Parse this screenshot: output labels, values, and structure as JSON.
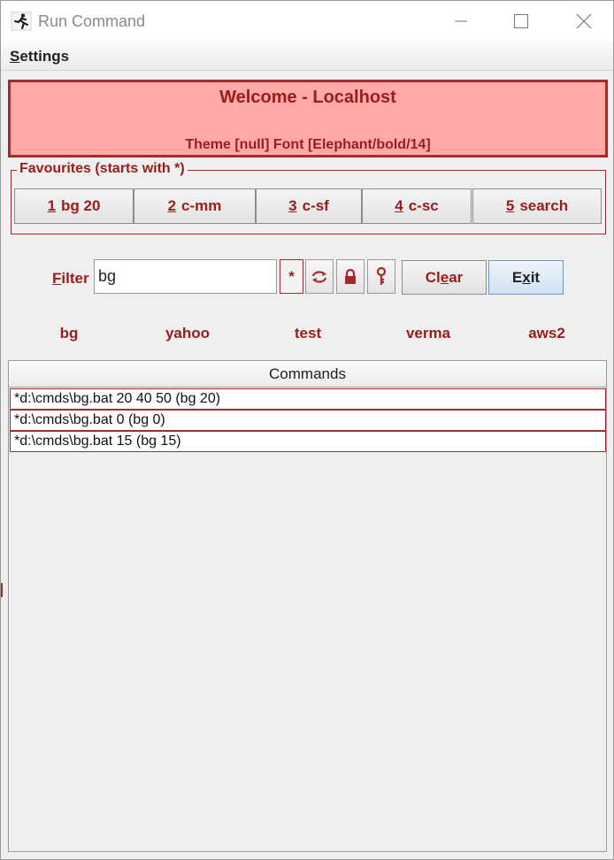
{
  "window": {
    "title": "Run Command",
    "icon": "running-man-icon",
    "controls": [
      "minimize-icon",
      "maximize-icon",
      "close-icon"
    ]
  },
  "menu": {
    "settings_mnemonic": "S",
    "settings_rest": "ettings"
  },
  "banner": {
    "title": "Welcome - Localhost",
    "subtitle": "Theme [null] Font [Elephant/bold/14]",
    "background": "#ffa9a9",
    "border": "#a52a2a"
  },
  "favourites": {
    "legend": "Favourites (starts with *)",
    "items": [
      {
        "num": "1",
        "label": "bg 20"
      },
      {
        "num": "2",
        "label": "c-mm"
      },
      {
        "num": "3",
        "label": "c-sf"
      },
      {
        "num": "4",
        "label": "c-sc"
      },
      {
        "num": "5",
        "label": "search"
      }
    ]
  },
  "filter": {
    "label_mnemonic": "F",
    "label_rest": "ilter",
    "value": "bg",
    "star_label": "*",
    "tool_icons": [
      "refresh-icon",
      "lock-icon",
      "key-icon"
    ]
  },
  "buttons": {
    "clear_pre": "Cl",
    "clear_mnemonic": "e",
    "clear_post": "ar",
    "exit_pre": "E",
    "exit_mnemonic": "x",
    "exit_post": "it"
  },
  "quick_links": [
    "bg",
    "yahoo",
    "test",
    "verma",
    "aws2"
  ],
  "commands": {
    "header": "Commands",
    "rows": [
      "*d:\\cmds\\bg.bat 20 40 50 (bg 20)",
      "*d:\\cmds\\bg.bat 0 (bg 0)",
      "*d:\\cmds\\bg.bat 15 (bg 15)"
    ]
  },
  "colors": {
    "accent": "#9b1c1c",
    "exit_button": "#cfe1f3"
  }
}
